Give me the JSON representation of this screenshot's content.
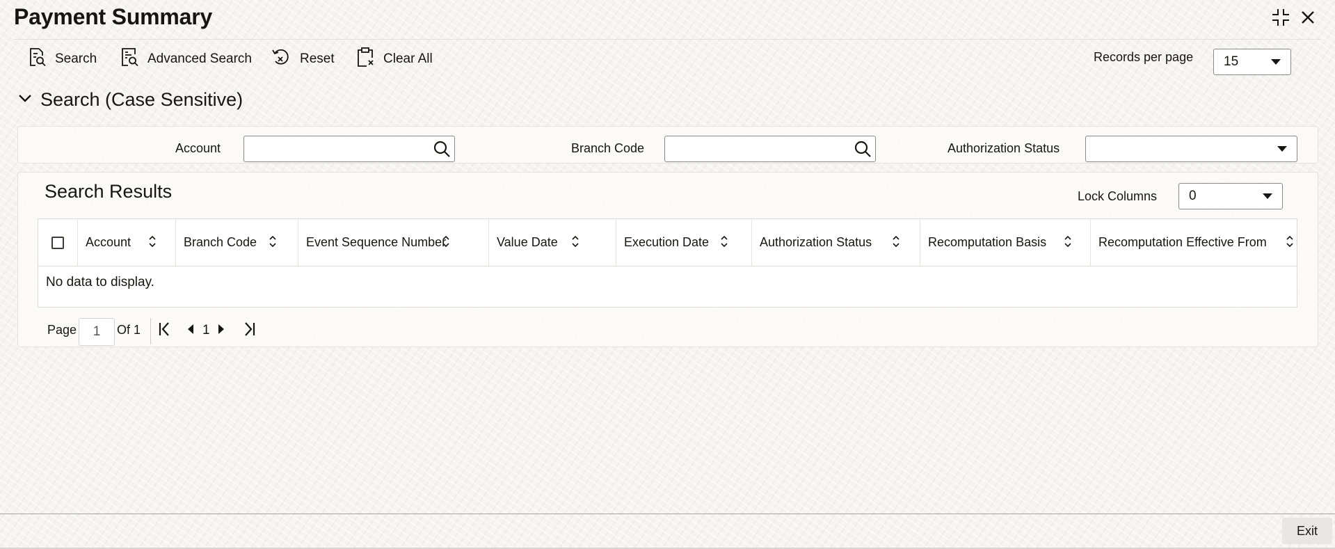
{
  "page": {
    "title": "Payment Summary"
  },
  "toolbar": {
    "search_label": "Search",
    "advanced_search_label": "Advanced Search",
    "reset_label": "Reset",
    "clear_all_label": "Clear All",
    "records_per_page_label": "Records per page",
    "records_per_page_value": "15"
  },
  "search_section": {
    "title": "Search (Case Sensitive)",
    "fields": {
      "account_label": "Account",
      "account_value": "",
      "branch_code_label": "Branch Code",
      "branch_code_value": "",
      "authorization_status_label": "Authorization Status",
      "authorization_status_value": ""
    }
  },
  "results": {
    "title": "Search Results",
    "lock_columns_label": "Lock Columns",
    "lock_columns_value": "0",
    "columns": [
      "Account",
      "Branch Code",
      "Event Sequence Number",
      "Value Date",
      "Execution Date",
      "Authorization Status",
      "Recomputation Basis",
      "Recomputation Effective From"
    ],
    "empty_message": "No data to display."
  },
  "pagination": {
    "page_label": "Page",
    "current_page": "1",
    "of_label": "Of 1",
    "page_number": "1"
  },
  "footer": {
    "exit_label": "Exit"
  },
  "icons": {
    "search": "search-doc-icon",
    "advanced_search": "advanced-search-icon",
    "reset": "reset-icon",
    "clear_all": "clear-clipboard-icon",
    "lov": "magnifier-icon",
    "minimize": "minimize-arrows-icon",
    "close": "close-icon"
  }
}
